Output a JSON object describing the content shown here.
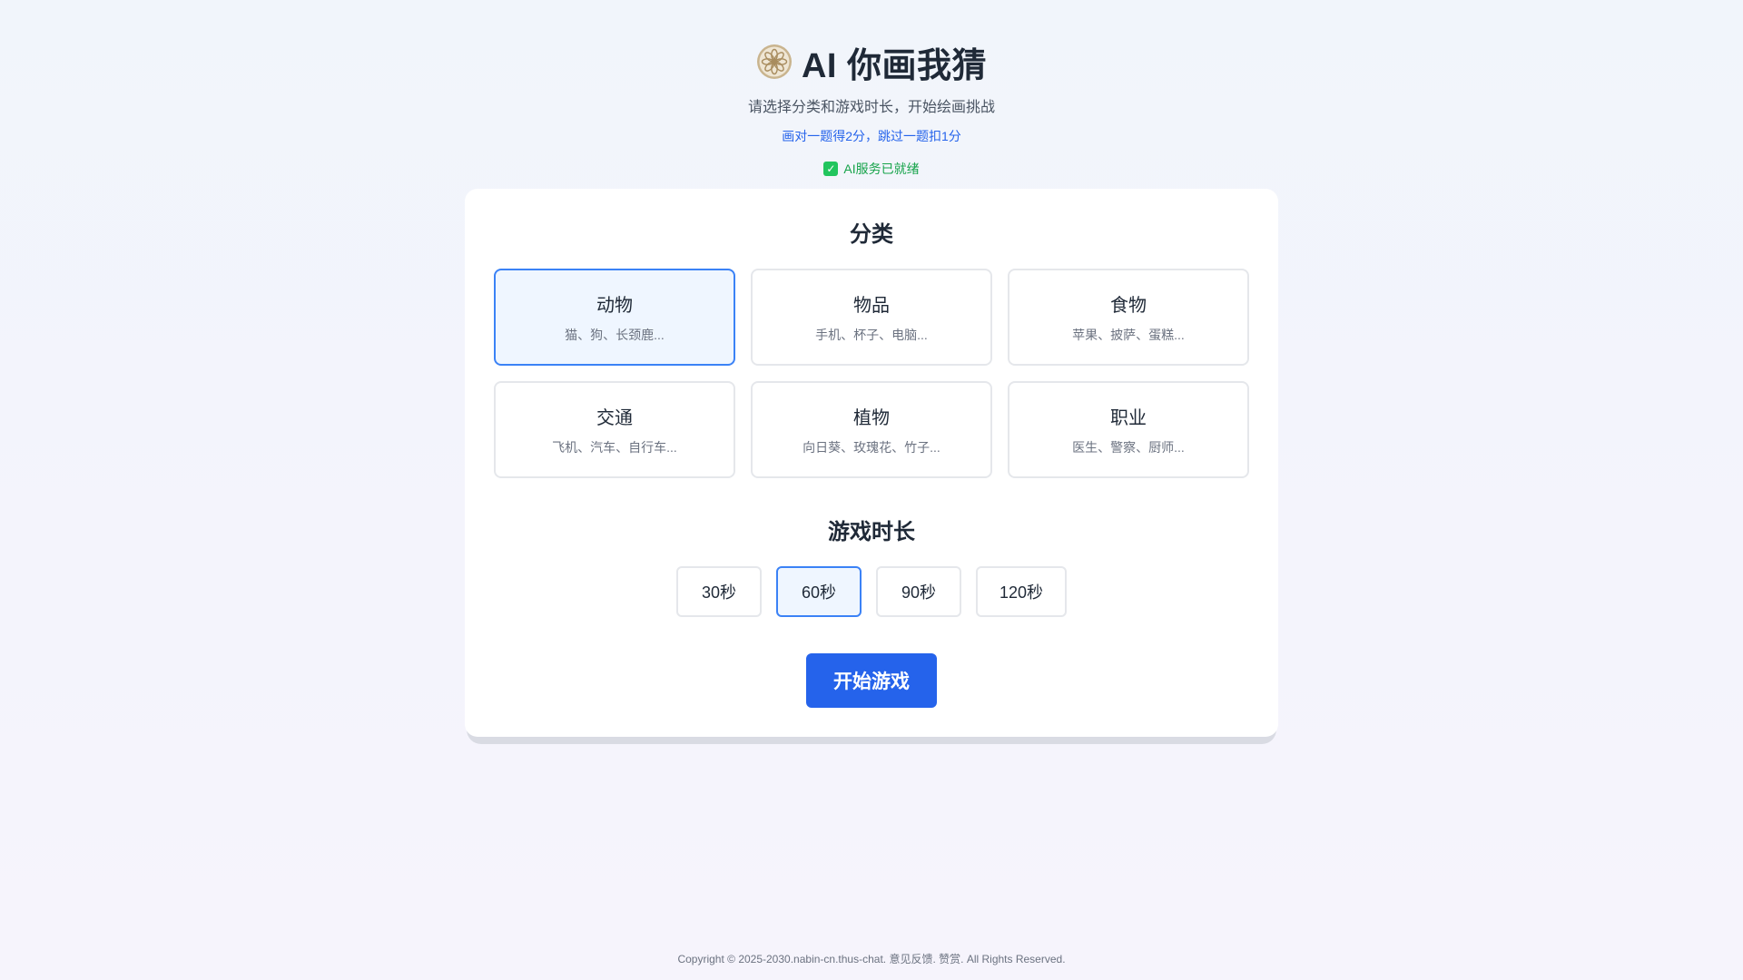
{
  "header": {
    "title": "AI 你画我猜",
    "logo_icon": "flower-emblem-icon",
    "subtitle": "请选择分类和游戏时长，开始绘画挑战",
    "rule": "画对一题得2分，跳过一题扣1分",
    "status": {
      "icon": "check-box-icon",
      "text": "AI服务已就绪",
      "color": "#16a34a"
    }
  },
  "category_section": {
    "title": "分类",
    "selected": "动物",
    "items": [
      {
        "name": "动物",
        "examples": "猫、狗、长颈鹿..."
      },
      {
        "name": "物品",
        "examples": "手机、杯子、电脑..."
      },
      {
        "name": "食物",
        "examples": "苹果、披萨、蛋糕..."
      },
      {
        "name": "交通",
        "examples": "飞机、汽车、自行车..."
      },
      {
        "name": "植物",
        "examples": "向日葵、玫瑰花、竹子..."
      },
      {
        "name": "职业",
        "examples": "医生、警察、厨师..."
      }
    ]
  },
  "duration_section": {
    "title": "游戏时长",
    "selected": "60秒",
    "options": [
      "30秒",
      "60秒",
      "90秒",
      "120秒"
    ]
  },
  "start_button": {
    "label": "开始游戏",
    "color": "#2563eb"
  },
  "accent_color": "#3b82f6",
  "footer": {
    "prefix": "Copyright © 2025-2030.",
    "site": "nabin-cn.thus-chat",
    "sep1": ". ",
    "feedback": "意见反馈",
    "sep2": ". ",
    "donate": "赞赏",
    "suffix": ". All Rights Reserved."
  }
}
